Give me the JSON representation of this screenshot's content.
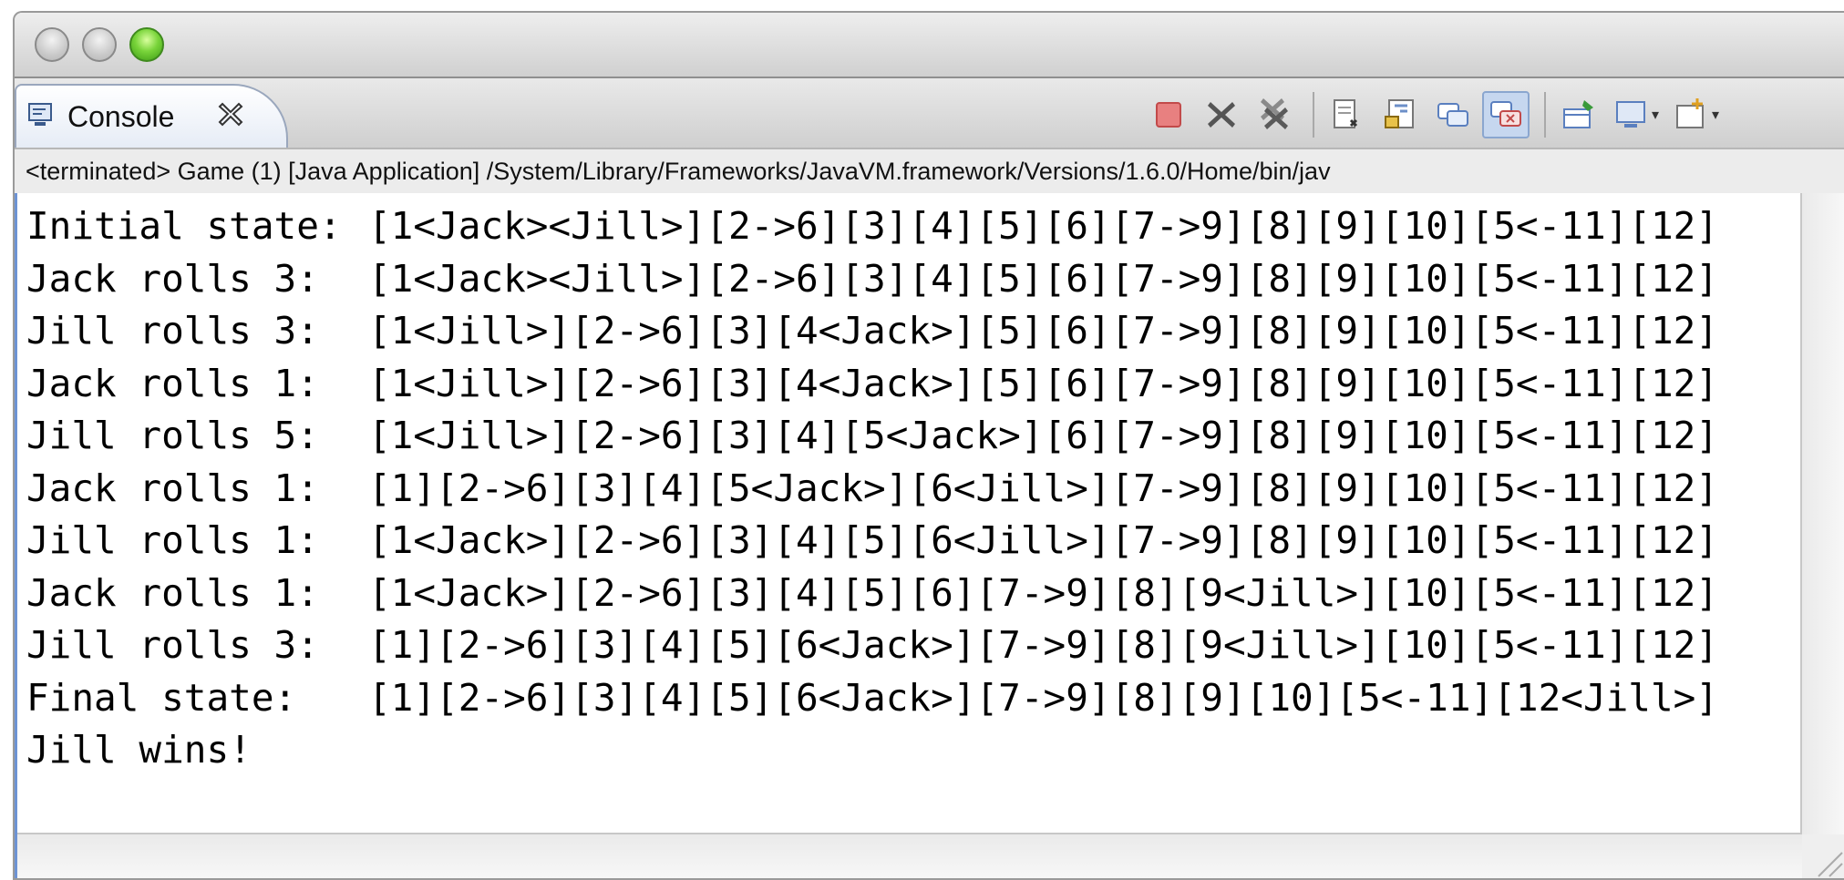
{
  "view": {
    "tab_label": "Console",
    "status": "<terminated> Game (1) [Java Application] /System/Library/Frameworks/JavaVM.framework/Versions/1.6.0/Home/bin/jav"
  },
  "icons": {
    "tab": "console-icon",
    "close": "close-tab-icon",
    "toolbar": [
      "terminate-icon",
      "remove-launch-icon",
      "remove-all-terminated-icon",
      "clear-console-icon",
      "scroll-lock-icon",
      "show-on-stdout-icon",
      "show-on-stderr-icon",
      "pin-console-icon",
      "display-selected-console-icon",
      "open-console-icon"
    ]
  },
  "colors": {
    "active_border": "#6d93d4",
    "terminate_red": "#e06060",
    "traffic_green": "#79d43a"
  },
  "output": [
    {
      "label": "Initial state:",
      "state": "[1<Jack><Jill>][2->6][3][4][5][6][7->9][8][9][10][5<-11][12]"
    },
    {
      "label": "Jack rolls 3:",
      "state": "[1<Jack><Jill>][2->6][3][4][5][6][7->9][8][9][10][5<-11][12]"
    },
    {
      "label": "Jill rolls 3:",
      "state": "[1<Jill>][2->6][3][4<Jack>][5][6][7->9][8][9][10][5<-11][12]"
    },
    {
      "label": "Jack rolls 1:",
      "state": "[1<Jill>][2->6][3][4<Jack>][5][6][7->9][8][9][10][5<-11][12]"
    },
    {
      "label": "Jill rolls 5:",
      "state": "[1<Jill>][2->6][3][4][5<Jack>][6][7->9][8][9][10][5<-11][12]"
    },
    {
      "label": "Jack rolls 1:",
      "state": "[1][2->6][3][4][5<Jack>][6<Jill>][7->9][8][9][10][5<-11][12]"
    },
    {
      "label": "Jill rolls 1:",
      "state": "[1<Jack>][2->6][3][4][5][6<Jill>][7->9][8][9][10][5<-11][12]"
    },
    {
      "label": "Jack rolls 1:",
      "state": "[1<Jack>][2->6][3][4][5][6][7->9][8][9<Jill>][10][5<-11][12]"
    },
    {
      "label": "Jill rolls 3:",
      "state": "[1][2->6][3][4][5][6<Jack>][7->9][8][9<Jill>][10][5<-11][12]"
    },
    {
      "label": "Final state:",
      "state": "[1][2->6][3][4][5][6<Jack>][7->9][8][9][10][5<-11][12<Jill>]"
    },
    {
      "label": "Jill wins!",
      "state": ""
    }
  ]
}
